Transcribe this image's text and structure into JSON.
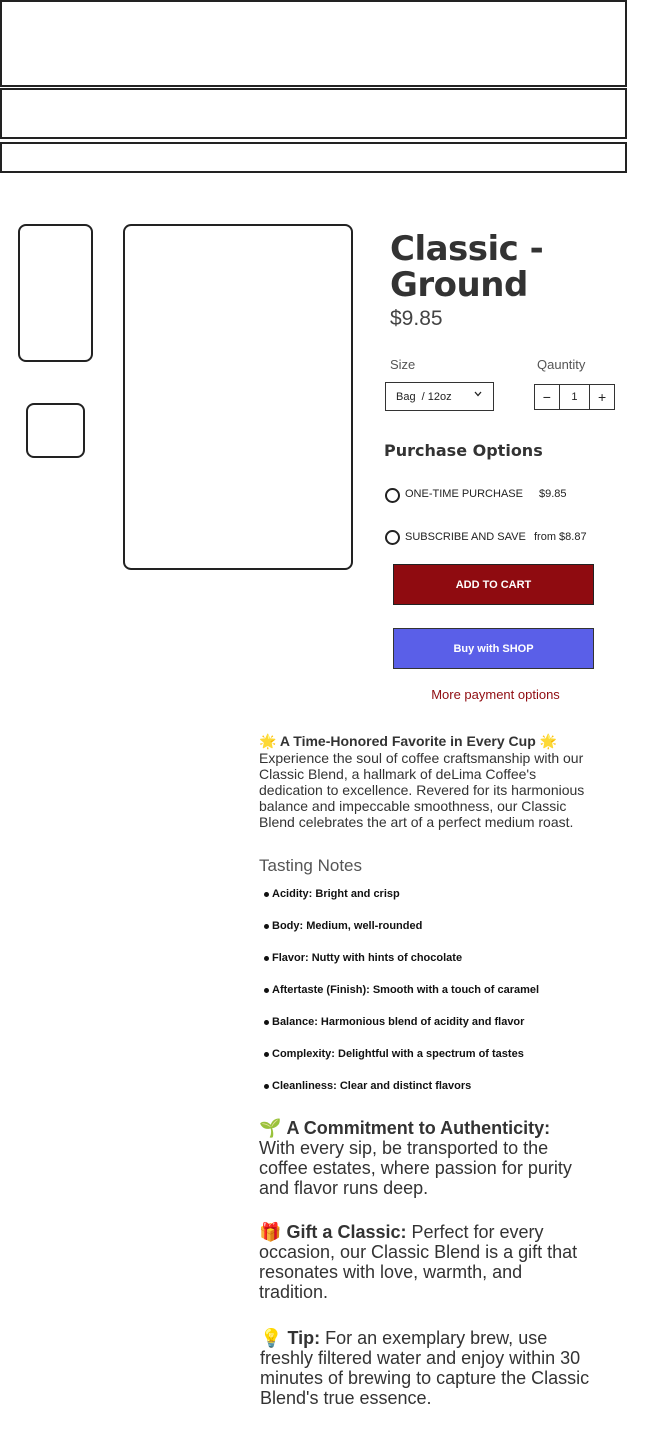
{
  "product": {
    "title_line1": "Classic -",
    "title_line2": "Ground",
    "price": "$9.85"
  },
  "size": {
    "label": "Size",
    "selected": "Bag  / 12oz",
    "chevron_icon": "chevron-down-icon"
  },
  "quantity": {
    "label": "Qauntity",
    "minus": "−",
    "value": "1",
    "plus": "+"
  },
  "purchase_options": {
    "title": "Purchase Options",
    "options": [
      {
        "label": "ONE-TIME PURCHASE",
        "price": "$9.85"
      },
      {
        "label": "SUBSCRIBE AND SAVE",
        "price": "from $8.87"
      }
    ]
  },
  "buttons": {
    "add_to_cart": "ADD TO CART",
    "buy_with_shop": "Buy with SHOP",
    "more_payment": "More payment options"
  },
  "description": {
    "heading_emoji": "🌟",
    "heading": "A Time-Honored Favorite in Every Cup",
    "heading_emoji_end": "🌟",
    "body": "Experience the soul of coffee craftsmanship with our Classic Blend, a hallmark of deLima Coffee's dedication to excellence. Revered for its harmonious balance and impeccable smoothness, our Classic Blend celebrates the art of a perfect medium roast.",
    "tasting_title": "Tasting Notes",
    "notes": [
      "Acidity: Bright and crisp",
      "Body: Medium, well-rounded",
      "Flavor: Nutty with hints of chocolate",
      "Aftertaste (Finish): Smooth with a touch of caramel",
      "Balance: Harmonious blend of acidity and flavor",
      "Complexity: Delightful with a spectrum of tastes",
      "Cleanliness: Clear and distinct flavors"
    ],
    "commitment_emoji": "🌱",
    "commitment_title": "A Commitment to Authenticity:",
    "commitment_body": "With every sip, be transported to the coffee estates, where passion for purity and flavor runs deep.",
    "gift_emoji": "🎁",
    "gift_title": "Gift a Classic:",
    "gift_body": " Perfect for every occasion, our Classic Blend is a gift that resonates with love, warmth, and tradition.",
    "tip_emoji": "💡",
    "tip_title": "Tip:",
    "tip_body": " For an exemplary brew, use freshly filtered water and enjoy within 30 minutes of brewing to capture the Classic Blend's true essence."
  },
  "colors": {
    "accent": "#8f0b10",
    "shop": "#5a5fe8",
    "text": "#333333"
  }
}
